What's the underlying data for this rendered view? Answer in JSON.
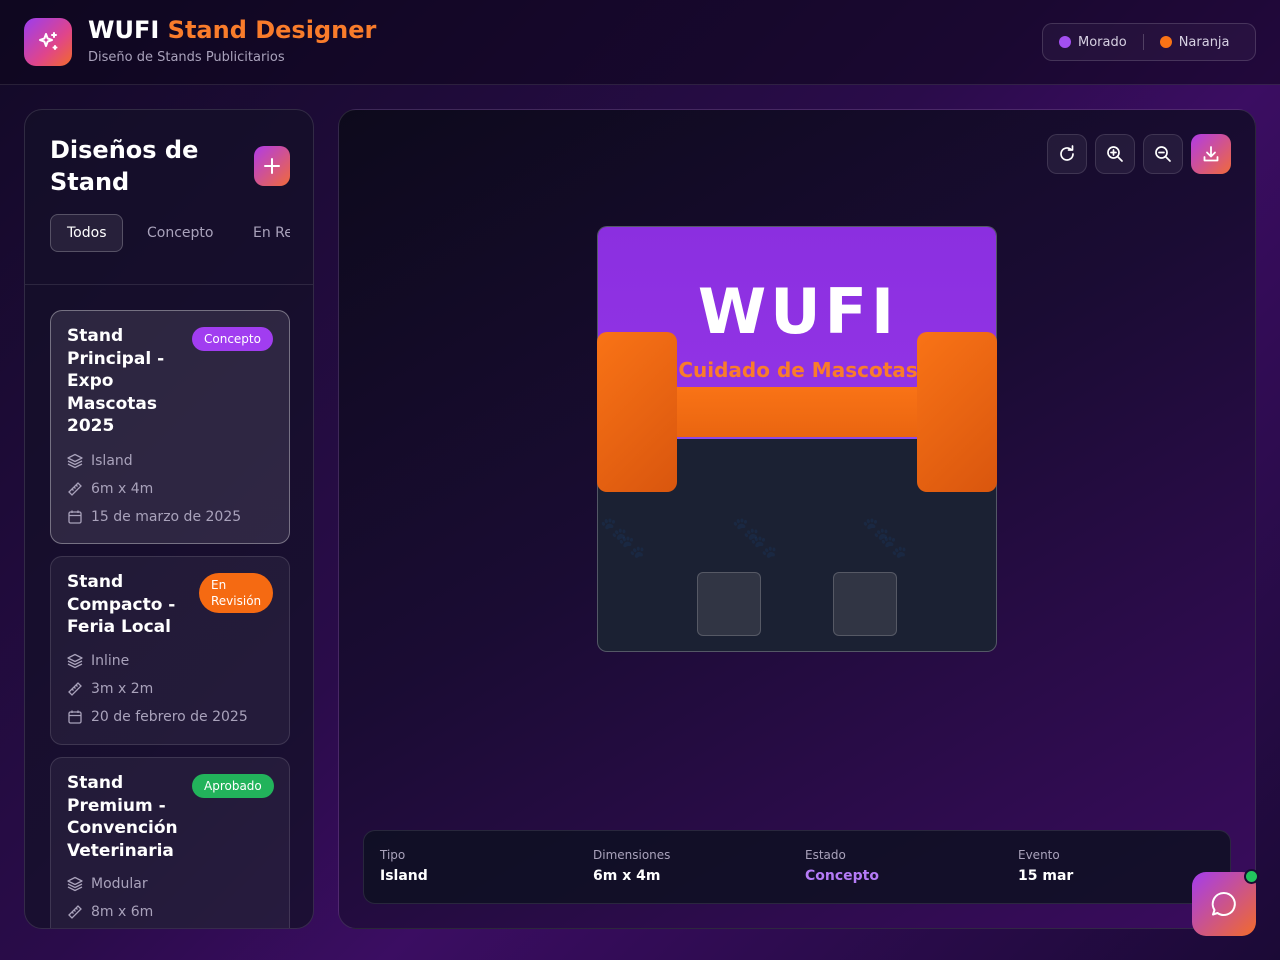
{
  "header": {
    "title_main": "WUFI",
    "title_accent": "Stand Designer",
    "subtitle": "Diseño de Stands Publicitarios",
    "palette": [
      {
        "label": "Morado",
        "color": "#a34ff0"
      },
      {
        "label": "Naranja",
        "color": "#f97316"
      }
    ]
  },
  "sidebar": {
    "title": "Diseños de Stand",
    "filters": [
      "Todos",
      "Concepto",
      "En Re"
    ],
    "designs": [
      {
        "title": "Stand Principal - Expo Mascotas 2025",
        "status": "Concepto",
        "type": "Island",
        "dimensions": "6m x 4m",
        "date": "15 de marzo de 2025"
      },
      {
        "title": "Stand Compacto - Feria Local",
        "status_line1": "En",
        "status_line2": "Revisión",
        "type": "Inline",
        "dimensions": "3m x 2m",
        "date": "20 de febrero de 2025"
      },
      {
        "title": "Stand Premium - Convención Veterinaria",
        "status": "Aprobado",
        "type": "Modular",
        "dimensions": "8m x 6m"
      }
    ]
  },
  "preview": {
    "brand": "WUFI",
    "tagline": "Cuidado de Mascotas",
    "paw": "🐾"
  },
  "details": {
    "tipo_label": "Tipo",
    "tipo": "Island",
    "dim_label": "Dimensiones",
    "dim": "6m x 4m",
    "estado_label": "Estado",
    "estado": "Concepto",
    "evento_label": "Evento",
    "evento": "15 mar"
  },
  "colors": {
    "purple": "#9b3df0",
    "orange": "#f97316",
    "concepto_badge": "#a13df0",
    "revision_badge": "#f56a12",
    "aprobado_badge": "#22b35b",
    "estado_text": "#b57bf7"
  },
  "icons": {
    "logo": "sparkles-icon",
    "add": "plus-icon",
    "type": "layers-icon",
    "dimensions": "ruler-icon",
    "date": "calendar-icon",
    "tools": [
      "rotate-icon",
      "zoom-in-icon",
      "zoom-out-icon",
      "download-icon"
    ],
    "chat": "message-circle-icon"
  }
}
